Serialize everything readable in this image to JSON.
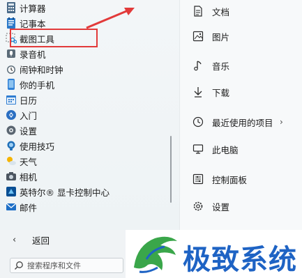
{
  "apps": [
    {
      "label": "计算器",
      "icon": "calculator-icon"
    },
    {
      "label": "记事本",
      "icon": "notepad-icon"
    },
    {
      "label": "截图工具",
      "icon": "snipping-tool-icon"
    },
    {
      "label": "录音机",
      "icon": "voice-recorder-icon"
    },
    {
      "label": "闹钟和时钟",
      "icon": "alarm-clock-icon"
    },
    {
      "label": "你的手机",
      "icon": "phone-icon"
    },
    {
      "label": "日历",
      "icon": "calendar-icon"
    },
    {
      "label": "入门",
      "icon": "get-started-icon"
    },
    {
      "label": "设置",
      "icon": "settings-icon"
    },
    {
      "label": "使用技巧",
      "icon": "tips-icon"
    },
    {
      "label": "天气",
      "icon": "weather-icon"
    },
    {
      "label": "相机",
      "icon": "camera-icon"
    },
    {
      "label": "英特尔® 显卡控制中心",
      "icon": "intel-graphics-icon"
    },
    {
      "label": "邮件",
      "icon": "mail-icon"
    }
  ],
  "places": [
    {
      "label": "文档",
      "icon": "document-icon"
    },
    {
      "label": "图片",
      "icon": "pictures-icon"
    },
    {
      "label": "音乐",
      "icon": "music-icon"
    },
    {
      "label": "下载",
      "icon": "download-icon"
    },
    {
      "label": "最近使用的项目",
      "icon": "recent-clock-icon",
      "chevron": "›"
    },
    {
      "label": "此电脑",
      "icon": "this-pc-icon"
    },
    {
      "label": "控制面板",
      "icon": "control-panel-icon"
    },
    {
      "label": "设置",
      "icon": "settings-gear-icon"
    }
  ],
  "back": {
    "label": "返回",
    "chevron": "‹"
  },
  "search": {
    "placeholder": "搜索程序和文件"
  },
  "watermark": {
    "text": "极致系统"
  },
  "colors": {
    "highlight": "#e23a3a",
    "accent": "#1e63c4"
  }
}
